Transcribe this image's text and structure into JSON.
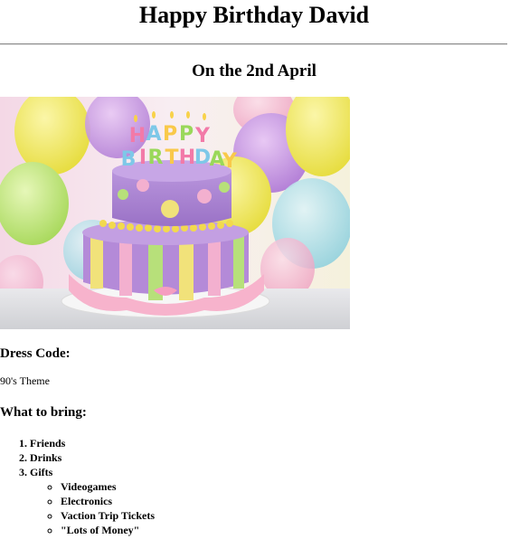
{
  "header": {
    "title": "Happy Birthday David",
    "date": "On the 2nd April"
  },
  "image": {
    "alt": "birthday cake"
  },
  "dress_code": {
    "heading": "Dress Code:",
    "value": "90's Theme"
  },
  "bring": {
    "heading": "What to bring:",
    "items": [
      "Friends",
      "Drinks",
      "Gifts"
    ],
    "gifts": [
      "Videogames",
      "Electronics",
      "Vaction Trip Tickets",
      "\"Lots of Money\""
    ]
  }
}
